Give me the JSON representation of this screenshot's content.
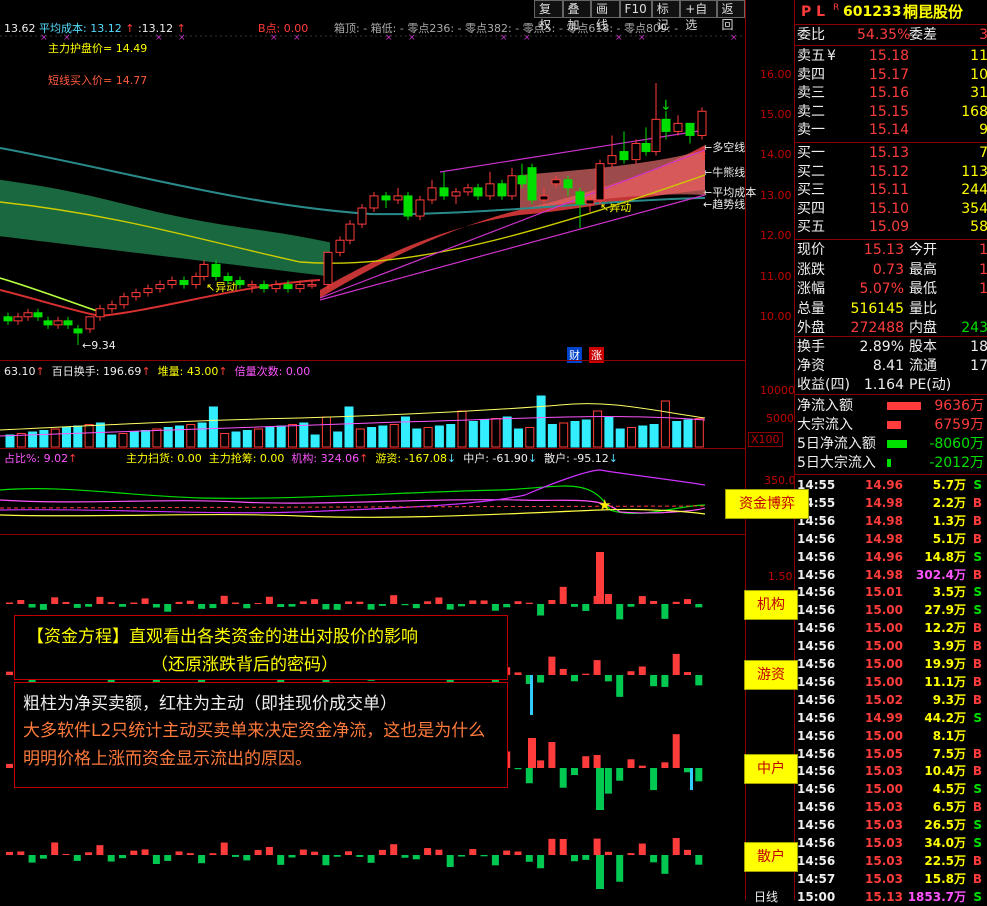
{
  "toolbar": [
    "复权",
    "叠加",
    "画线",
    "F10",
    "标记",
    "+自选",
    "返回"
  ],
  "header": {
    "left_val": "13.62",
    "avg_cost_label": "平均成本:",
    "avg_cost": "13.12",
    "val2": ":13.12",
    "b_point": "B点: 0.00",
    "levels": "箱顶: - 箱低: - 零点236: - 零点382: - 零点5: - 零点618: - 零点809: -"
  },
  "price_annotations": {
    "main_support": "主力护盘价= 14.49",
    "short_buy": "短线买入价= 14.77",
    "low_mark": "9.34",
    "yidong1": "异动",
    "yidong2": "异动",
    "duokong": "多空线",
    "niuxiong": "牛熊线",
    "pingjun": "平均成本",
    "qushi": "趋势线",
    "cai": "财",
    "zhang": "涨"
  },
  "price_axis": [
    "16.00",
    "15.00",
    "14.00",
    "13.00",
    "12.00",
    "11.00",
    "10.00"
  ],
  "volume_header": {
    "v1": "63.10",
    "v2_label": "百日换手:",
    "v2": "196.69",
    "v3_label": "堆量:",
    "v3": "43.00",
    "v4_label": "倍量次数:",
    "v4": "0.00"
  },
  "volume_axis": [
    "10000",
    "5000",
    "X100"
  ],
  "fund_header": {
    "f1": "占比%: 9.02",
    "f2": "主力扫货: 0.00",
    "f3": "主力抢筹: 0.00",
    "f4": "机构: 324.06",
    "f5": "游资: -167.08",
    "f6": "中户: -61.90",
    "f7": "散户: -95.12"
  },
  "fund_axis": [
    "350.0",
    "1.50"
  ],
  "side_buttons": {
    "b1": "资金博弈",
    "b2": "机构",
    "b3": "游资",
    "b4": "中户",
    "b5": "散户",
    "b6": "日线"
  },
  "annotation": {
    "title_bracket": "【资金方程】",
    "title_rest": "直观看出各类资金的进出对股价的影响",
    "subtitle": "（还原涨跌背后的密码）",
    "line1": "粗柱为净买卖额，红柱为主动（即挂现价成交单）",
    "line2": "大多软件L2只统计主动买卖单来决定资金净流，这也是为什么明明价格上涨而资金显示流出的原因。"
  },
  "quote": {
    "pl": "P L",
    "r_mark": "R",
    "code": "601233",
    "name": "桐昆股份",
    "weibi_label": "委比",
    "weibi": "54.35%",
    "weicha_label": "委差",
    "weicha": "3",
    "asks": [
      {
        "label": "卖五",
        "mark": "¥",
        "price": "15.18",
        "vol": "11"
      },
      {
        "label": "卖四",
        "mark": "",
        "price": "15.17",
        "vol": "10"
      },
      {
        "label": "卖三",
        "mark": "",
        "price": "15.16",
        "vol": "31"
      },
      {
        "label": "卖二",
        "mark": "",
        "price": "15.15",
        "vol": "168"
      },
      {
        "label": "卖一",
        "mark": "",
        "price": "15.14",
        "vol": "9"
      }
    ],
    "bids": [
      {
        "label": "买一",
        "price": "15.13",
        "vol": "7"
      },
      {
        "label": "买二",
        "price": "15.12",
        "vol": "113"
      },
      {
        "label": "买三",
        "price": "15.11",
        "vol": "244"
      },
      {
        "label": "买四",
        "price": "15.10",
        "vol": "354"
      },
      {
        "label": "买五",
        "price": "15.09",
        "vol": "58"
      }
    ],
    "stats": [
      {
        "l1": "现价",
        "v1": "15.13",
        "l2": "今开",
        "v2": "1"
      },
      {
        "l1": "涨跌",
        "v1": "0.73",
        "l2": "最高",
        "v2": "1"
      },
      {
        "l1": "涨幅",
        "v1": "5.07%",
        "l2": "最低",
        "v2": "1"
      },
      {
        "l1": "总量",
        "v1": "516145",
        "l2": "量比",
        "v2": ""
      },
      {
        "l1": "外盘",
        "v1": "272488",
        "l2": "内盘",
        "v2": "243"
      }
    ],
    "stats2": [
      {
        "l1": "换手",
        "v1": "2.89%",
        "l2": "股本",
        "v2": "18"
      },
      {
        "l1": "净资",
        "v1": "8.41",
        "l2": "流通",
        "v2": "17"
      },
      {
        "l1": "收益(四)",
        "v1": "1.164",
        "l2": "PE(动)",
        "v2": ""
      }
    ],
    "flows": [
      {
        "label": "净流入额",
        "value": "9636万",
        "color": "#ff3c3c",
        "bar": 34
      },
      {
        "label": "大宗流入",
        "value": "6759万",
        "color": "#ff3c3c",
        "bar": 14
      },
      {
        "label": "5日净流入额",
        "value": "-8060万",
        "color": "#00e000",
        "bar": 20
      },
      {
        "label": "5日大宗流入",
        "value": "-2012万",
        "color": "#00e000",
        "bar": 4
      }
    ],
    "ticks": [
      {
        "t": "14:55",
        "p": "14.96",
        "v": "5.7万",
        "s": "S"
      },
      {
        "t": "14:55",
        "p": "14.98",
        "v": "2.2万",
        "s": "B"
      },
      {
        "t": "14:56",
        "p": "14.98",
        "v": "1.3万",
        "s": "B"
      },
      {
        "t": "14:56",
        "p": "14.98",
        "v": "5.1万",
        "s": "B"
      },
      {
        "t": "14:56",
        "p": "14.96",
        "v": "14.8万",
        "s": "S"
      },
      {
        "t": "14:56",
        "p": "14.98",
        "v": "302.4万",
        "s": "B"
      },
      {
        "t": "14:56",
        "p": "15.01",
        "v": "3.5万",
        "s": "S"
      },
      {
        "t": "14:56",
        "p": "15.00",
        "v": "27.9万",
        "s": "S"
      },
      {
        "t": "14:56",
        "p": "15.00",
        "v": "12.2万",
        "s": "B"
      },
      {
        "t": "14:56",
        "p": "15.00",
        "v": "3.9万",
        "s": "B"
      },
      {
        "t": "14:56",
        "p": "15.00",
        "v": "19.9万",
        "s": "B"
      },
      {
        "t": "14:56",
        "p": "15.00",
        "v": "11.1万",
        "s": "B"
      },
      {
        "t": "14:56",
        "p": "15.02",
        "v": "9.3万",
        "s": "B"
      },
      {
        "t": "14:56",
        "p": "14.99",
        "v": "44.2万",
        "s": "S"
      },
      {
        "t": "14:56",
        "p": "15.00",
        "v": "8.1万",
        "s": ""
      },
      {
        "t": "14:56",
        "p": "15.05",
        "v": "7.5万",
        "s": "B"
      },
      {
        "t": "14:56",
        "p": "15.03",
        "v": "10.4万",
        "s": "B"
      },
      {
        "t": "14:56",
        "p": "15.00",
        "v": "4.5万",
        "s": "S"
      },
      {
        "t": "14:56",
        "p": "15.03",
        "v": "6.5万",
        "s": "B"
      },
      {
        "t": "14:56",
        "p": "15.03",
        "v": "26.5万",
        "s": "S"
      },
      {
        "t": "14:56",
        "p": "15.03",
        "v": "34.0万",
        "s": "S"
      },
      {
        "t": "14:56",
        "p": "15.03",
        "v": "22.5万",
        "s": "B"
      },
      {
        "t": "14:57",
        "p": "15.03",
        "v": "15.8万",
        "s": "B"
      },
      {
        "t": "15:00",
        "p": "15.13",
        "v": "1853.7万",
        "s": "S"
      }
    ]
  },
  "colors": {
    "up": "#ff3c3c",
    "down": "#00e000",
    "panel_border": "#8b0000",
    "label_yellow": "#ffff00",
    "cyan": "#55ddff"
  }
}
